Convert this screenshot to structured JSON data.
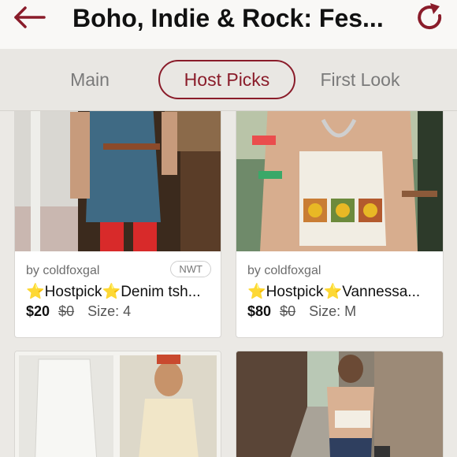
{
  "header": {
    "title": "Boho, Indie & Rock: Fes...",
    "back_icon": "arrow-left-icon",
    "refresh_icon": "refresh-icon"
  },
  "tabs": [
    {
      "label": "Main",
      "selected": false
    },
    {
      "label": "Host Picks",
      "selected": true
    },
    {
      "label": "First Look",
      "selected": false
    }
  ],
  "listings": [
    {
      "seller": "by coldfoxgal",
      "badge": "NWT",
      "star1": "⭐",
      "pick": "Hostpick",
      "star2": "⭐",
      "name": "Denim tsh...",
      "price": "$20",
      "original": "$0",
      "size": "Size: 4"
    },
    {
      "seller": "by coldfoxgal",
      "badge": "",
      "star1": "⭐",
      "pick": "Hostpick",
      "star2": "⭐",
      "name": "Vannessa...",
      "price": "$80",
      "original": "$0",
      "size": "Size: M"
    }
  ],
  "colors": {
    "accent": "#8a1c2a",
    "background": "#ebe9e5"
  }
}
